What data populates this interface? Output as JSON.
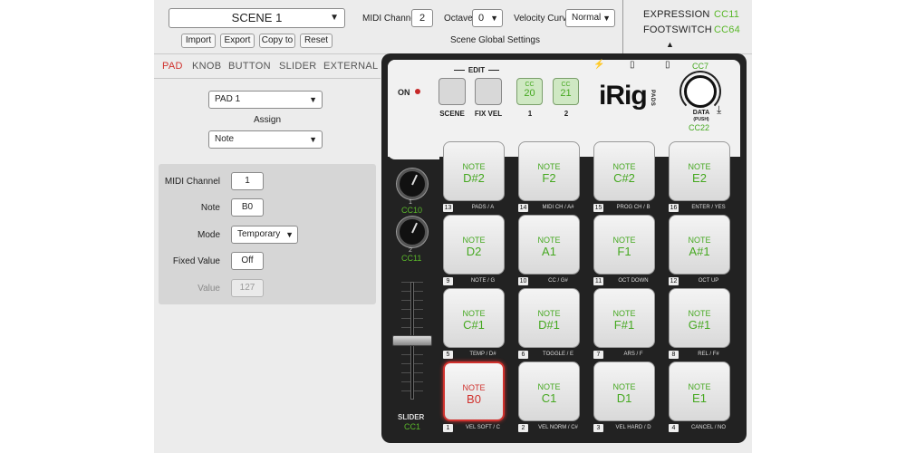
{
  "topbar": {
    "scene": "SCENE 1",
    "buttons": [
      "Import",
      "Export",
      "Copy to",
      "Reset"
    ],
    "midi_channel_label": "MIDI Channel",
    "midi_channel_value": "2",
    "octave_label": "Octave",
    "octave_value": "0",
    "velocity_label": "Velocity Curve",
    "velocity_value": "Normal",
    "global_label": "Scene Global Settings"
  },
  "right_panel": {
    "expression_label": "EXPRESSION",
    "expression_cc": "CC11",
    "footswitch_label": "FOOTSWITCH",
    "footswitch_cc": "CC64"
  },
  "tabs": [
    "PAD",
    "KNOB",
    "BUTTON",
    "SLIDER",
    "EXTERNAL"
  ],
  "form": {
    "pad_select": "PAD 1",
    "assign_label": "Assign",
    "assign_value": "Note",
    "midi_channel_label": "MIDI Channel",
    "midi_channel_value": "1",
    "note_label": "Note",
    "note_value": "B0",
    "mode_label": "Mode",
    "mode_value": "Temporary",
    "fixed_label": "Fixed Value",
    "fixed_value": "Off",
    "value_label": "Value",
    "value_value": "127"
  },
  "device": {
    "on_label": "ON",
    "edit_label": "EDIT",
    "scene_label": "SCENE",
    "fixvel_label": "FIX VEL",
    "cc_prefix": "CC",
    "cc1_value": "20",
    "cc2_value": "21",
    "btn1_num": "1",
    "btn2_num": "2",
    "logo": "iRig",
    "logo_sub": "PADS",
    "cc7": "CC7",
    "data_label": "DATA",
    "data_sub": "(PUSH)",
    "data_cc": "CC22",
    "knob1_num": "1",
    "knob1_cc": "CC10",
    "knob2_num": "2",
    "knob2_cc": "CC11",
    "slider_label": "SLIDER",
    "slider_cc": "CC1",
    "pads": [
      {
        "type": "NOTE",
        "note": "D#2",
        "num": "13",
        "caption": "PADS / A"
      },
      {
        "type": "NOTE",
        "note": "F2",
        "num": "14",
        "caption": "MIDI CH / A#"
      },
      {
        "type": "NOTE",
        "note": "C#2",
        "num": "15",
        "caption": "PROG CH / B"
      },
      {
        "type": "NOTE",
        "note": "E2",
        "num": "16",
        "caption": "ENTER / YES"
      },
      {
        "type": "NOTE",
        "note": "D2",
        "num": "9",
        "caption": "NOTE / G"
      },
      {
        "type": "NOTE",
        "note": "A1",
        "num": "10",
        "caption": "CC / G#"
      },
      {
        "type": "NOTE",
        "note": "F1",
        "num": "11",
        "caption": "OCT DOWN"
      },
      {
        "type": "NOTE",
        "note": "A#1",
        "num": "12",
        "caption": "OCT UP"
      },
      {
        "type": "NOTE",
        "note": "C#1",
        "num": "5",
        "caption": "TEMP / D#"
      },
      {
        "type": "NOTE",
        "note": "D#1",
        "num": "6",
        "caption": "TOGGLE / E"
      },
      {
        "type": "NOTE",
        "note": "F#1",
        "num": "7",
        "caption": "ARS / F"
      },
      {
        "type": "NOTE",
        "note": "G#1",
        "num": "8",
        "caption": "REL / F#"
      },
      {
        "type": "NOTE",
        "note": "B0",
        "num": "1",
        "caption": "VEL SOFT / C"
      },
      {
        "type": "NOTE",
        "note": "C1",
        "num": "2",
        "caption": "VEL NORM / C#"
      },
      {
        "type": "NOTE",
        "note": "D1",
        "num": "3",
        "caption": "VEL HARD / D"
      },
      {
        "type": "NOTE",
        "note": "E1",
        "num": "4",
        "caption": "CANCEL / NO"
      }
    ]
  },
  "colors": {
    "accent_green": "#5ab82a",
    "active_red": "#d0312d"
  }
}
